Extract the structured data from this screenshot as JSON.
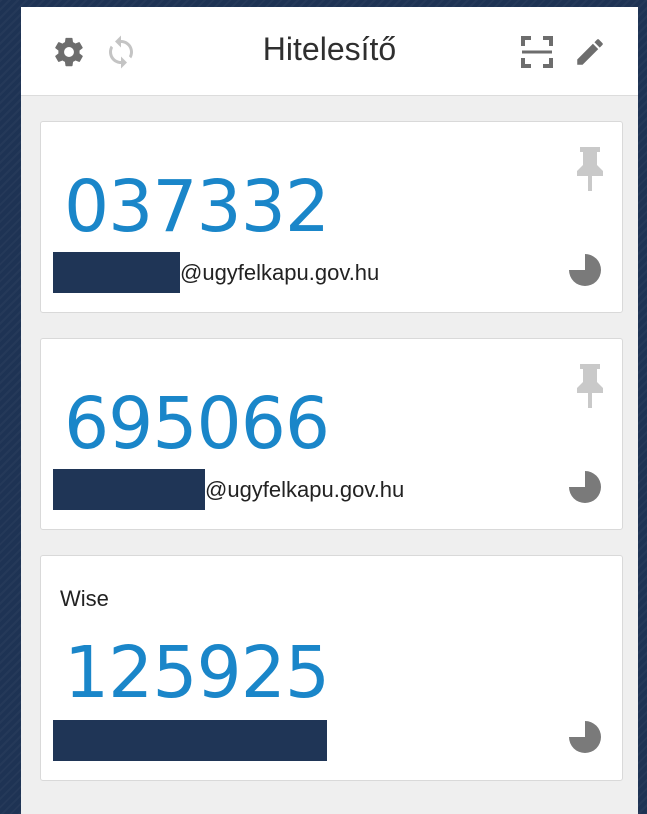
{
  "header": {
    "title": "Hitelesítő",
    "icons": [
      "gear-icon",
      "sync-icon",
      "scan-qr-icon",
      "edit-icon"
    ]
  },
  "entries": [
    {
      "issuer": "",
      "code": "037332",
      "account_suffix": "@ugyfelkapu.gov.hu",
      "pinned_icon": "pin-icon",
      "timer_icon": "timer-pie-icon",
      "timer_remaining_fraction": 0.75
    },
    {
      "issuer": "",
      "code": "695066",
      "account_suffix": "@ugyfelkapu.gov.hu",
      "pinned_icon": "pin-icon",
      "timer_icon": "timer-pie-icon",
      "timer_remaining_fraction": 0.75
    },
    {
      "issuer": "Wise",
      "code": "125925",
      "account_suffix": "",
      "timer_icon": "timer-pie-icon",
      "timer_remaining_fraction": 0.75
    }
  ],
  "colors": {
    "code": "#1a86c9",
    "icon": "#7a7a7a",
    "redaction": "#1f3556",
    "background": "#1e3354"
  }
}
